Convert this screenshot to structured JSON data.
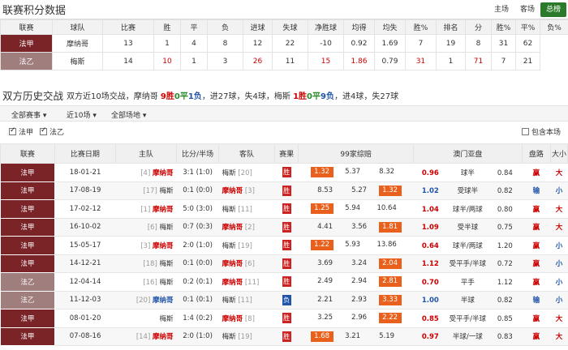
{
  "header": {
    "title": "联赛积分数据",
    "tabs": [
      "主场",
      "客场",
      "总榜"
    ]
  },
  "standings": {
    "columns": [
      "联赛",
      "球队",
      "比赛",
      "胜",
      "平",
      "负",
      "进球",
      "失球",
      "净胜球",
      "均得",
      "均失",
      "胜%",
      "排名",
      "分",
      "胜%",
      "平%",
      "负%"
    ],
    "rows": [
      {
        "league": "法甲",
        "team": "摩纳哥",
        "cells": [
          "13",
          "1",
          "4",
          "8",
          "12",
          "22",
          "-10",
          "0.92",
          "1.69",
          "7",
          "19",
          "8",
          "31",
          "62"
        ],
        "alt": false
      },
      {
        "league": "法乙",
        "team": "梅斯",
        "cells": [
          "14",
          "10",
          "1",
          "3",
          "26",
          "11",
          "15",
          "1.86",
          "0.79",
          "31",
          "1",
          "71",
          "7",
          "21"
        ],
        "alt": true
      }
    ]
  },
  "history": {
    "title": "双方历史交战",
    "summary": {
      "p1": "双方近10场交战，摩纳哥 ",
      "w": "9胜",
      "d": "0平",
      "l": "1负",
      "p2": "，进27球，失4球，梅斯 ",
      "w2": "1胜",
      "d2": "0平",
      "l2": "9负",
      "p3": "，进4球，失27球"
    },
    "filters": [
      "全部赛事 ▾",
      "近10场 ▾",
      "全部场地 ▾"
    ],
    "checks": [
      {
        "label": "法甲",
        "on": true
      },
      {
        "label": "法乙",
        "on": true
      }
    ],
    "same_venue": "包含本场",
    "columns": [
      "联赛",
      "比赛日期",
      "主队",
      "比分/半场",
      "客队",
      "赛果",
      "99家综赔",
      "澳门亚盘",
      "盘路",
      "大小"
    ],
    "rows": [
      {
        "league": "法甲",
        "alt": false,
        "date": "18-01-21",
        "home_rank": "[4]",
        "home": "摩纳哥",
        "home_red": true,
        "score": "3:1 (1:0)",
        "away": "梅斯",
        "away_rank": "[20]",
        "away_red": false,
        "result": "胜",
        "o1": "1.32",
        "o2": "5.37",
        "o3": "8.32",
        "o_hl": 0,
        "ah1": "0.96",
        "ah_line": "球半",
        "ah2": "0.84",
        "ah_red": true,
        "pan": "赢",
        "pan_red": true,
        "ou": "大",
        "ou_red": true
      },
      {
        "league": "法甲",
        "alt": false,
        "date": "17-08-19",
        "home_rank": "[17]",
        "home": "梅斯",
        "home_red": false,
        "score": "0:1 (0:0)",
        "away": "摩纳哥",
        "away_rank": "[3]",
        "away_red": true,
        "result": "胜",
        "o1": "8.53",
        "o2": "5.27",
        "o3": "1.32",
        "o_hl": 2,
        "ah1": "1.02",
        "ah_line": "受球半",
        "ah2": "0.82",
        "ah_red": false,
        "pan": "输",
        "pan_red": false,
        "ou": "小",
        "ou_red": false
      },
      {
        "league": "法甲",
        "alt": false,
        "date": "17-02-12",
        "home_rank": "[1]",
        "home": "摩纳哥",
        "home_red": true,
        "score": "5:0 (3:0)",
        "away": "梅斯",
        "away_rank": "[11]",
        "away_red": false,
        "result": "胜",
        "o1": "1.25",
        "o2": "5.94",
        "o3": "10.64",
        "o_hl": 0,
        "ah1": "1.04",
        "ah_line": "球半/两球",
        "ah2": "0.80",
        "ah_red": true,
        "pan": "赢",
        "pan_red": true,
        "ou": "大",
        "ou_red": true
      },
      {
        "league": "法甲",
        "alt": false,
        "date": "16-10-02",
        "home_rank": "[6]",
        "home": "梅斯",
        "home_red": false,
        "score": "0:7 (0:3)",
        "away": "摩纳哥",
        "away_rank": "[2]",
        "away_red": true,
        "result": "胜",
        "o1": "4.41",
        "o2": "3.56",
        "o3": "1.81",
        "o_hl": 2,
        "ah1": "1.09",
        "ah_line": "受半球",
        "ah2": "0.75",
        "ah_red": true,
        "pan": "赢",
        "pan_red": true,
        "ou": "大",
        "ou_red": true
      },
      {
        "league": "法甲",
        "alt": false,
        "date": "15-05-17",
        "home_rank": "[3]",
        "home": "摩纳哥",
        "home_red": true,
        "score": "2:0 (1:0)",
        "away": "梅斯",
        "away_rank": "[19]",
        "away_red": false,
        "result": "胜",
        "o1": "1.22",
        "o2": "5.93",
        "o3": "13.86",
        "o_hl": 0,
        "ah1": "0.64",
        "ah_line": "球半/两球",
        "ah2": "1.20",
        "ah_red": true,
        "pan": "赢",
        "pan_red": true,
        "ou": "小",
        "ou_red": false
      },
      {
        "league": "法甲",
        "alt": false,
        "date": "14-12-21",
        "home_rank": "[18]",
        "home": "梅斯",
        "home_red": false,
        "score": "0:1 (0:0)",
        "away": "摩纳哥",
        "away_rank": "[6]",
        "away_red": true,
        "result": "胜",
        "o1": "3.69",
        "o2": "3.24",
        "o3": "2.04",
        "o_hl": 2,
        "ah1": "1.12",
        "ah_line": "受平手/半球",
        "ah2": "0.72",
        "ah_red": true,
        "pan": "赢",
        "pan_red": true,
        "ou": "小",
        "ou_red": false
      },
      {
        "league": "法乙",
        "alt": true,
        "date": "12-04-14",
        "home_rank": "[16]",
        "home": "梅斯",
        "home_red": false,
        "score": "0:2 (0:1)",
        "away": "摩纳哥",
        "away_rank": "[11]",
        "away_red": true,
        "result": "胜",
        "o1": "2.49",
        "o2": "2.94",
        "o3": "2.81",
        "o_hl": 2,
        "ah1": "0.70",
        "ah_line": "平手",
        "ah2": "1.12",
        "ah_red": true,
        "pan": "赢",
        "pan_red": true,
        "ou": "小",
        "ou_red": false
      },
      {
        "league": "法乙",
        "alt": true,
        "date": "11-12-03",
        "home_rank": "[20]",
        "home": "摩纳哥",
        "home_red": false,
        "home_blue": true,
        "score": "0:1 (0:1)",
        "away": "梅斯",
        "away_rank": "[11]",
        "away_red": false,
        "result": "负",
        "o1": "2.21",
        "o2": "2.93",
        "o3": "3.33",
        "o_hl": 2,
        "ah1": "1.00",
        "ah_line": "半球",
        "ah2": "0.82",
        "ah_red": false,
        "pan": "输",
        "pan_red": false,
        "ou": "小",
        "ou_red": false
      },
      {
        "league": "法甲",
        "alt": false,
        "date": "08-01-20",
        "home_rank": "",
        "home": "梅斯",
        "home_red": false,
        "score": "1:4 (0:2)",
        "away": "摩纳哥",
        "away_rank": "[8]",
        "away_red": true,
        "result": "胜",
        "o1": "3.25",
        "o2": "2.96",
        "o3": "2.22",
        "o_hl": 2,
        "ah1": "0.85",
        "ah_line": "受平手/半球",
        "ah2": "0.85",
        "ah_red": true,
        "pan": "赢",
        "pan_red": true,
        "ou": "大",
        "ou_red": true
      },
      {
        "league": "法甲",
        "alt": false,
        "date": "07-08-16",
        "home_rank": "[14]",
        "home": "摩纳哥",
        "home_red": true,
        "score": "2:0 (1:0)",
        "away": "梅斯",
        "away_rank": "[19]",
        "away_red": false,
        "result": "胜",
        "o1": "1.68",
        "o2": "3.21",
        "o3": "5.19",
        "o_hl": 0,
        "ah1": "0.97",
        "ah_line": "半球/一球",
        "ah2": "0.83",
        "ah_red": true,
        "pan": "赢",
        "pan_red": true,
        "ou": "大",
        "ou_red": true
      }
    ]
  }
}
